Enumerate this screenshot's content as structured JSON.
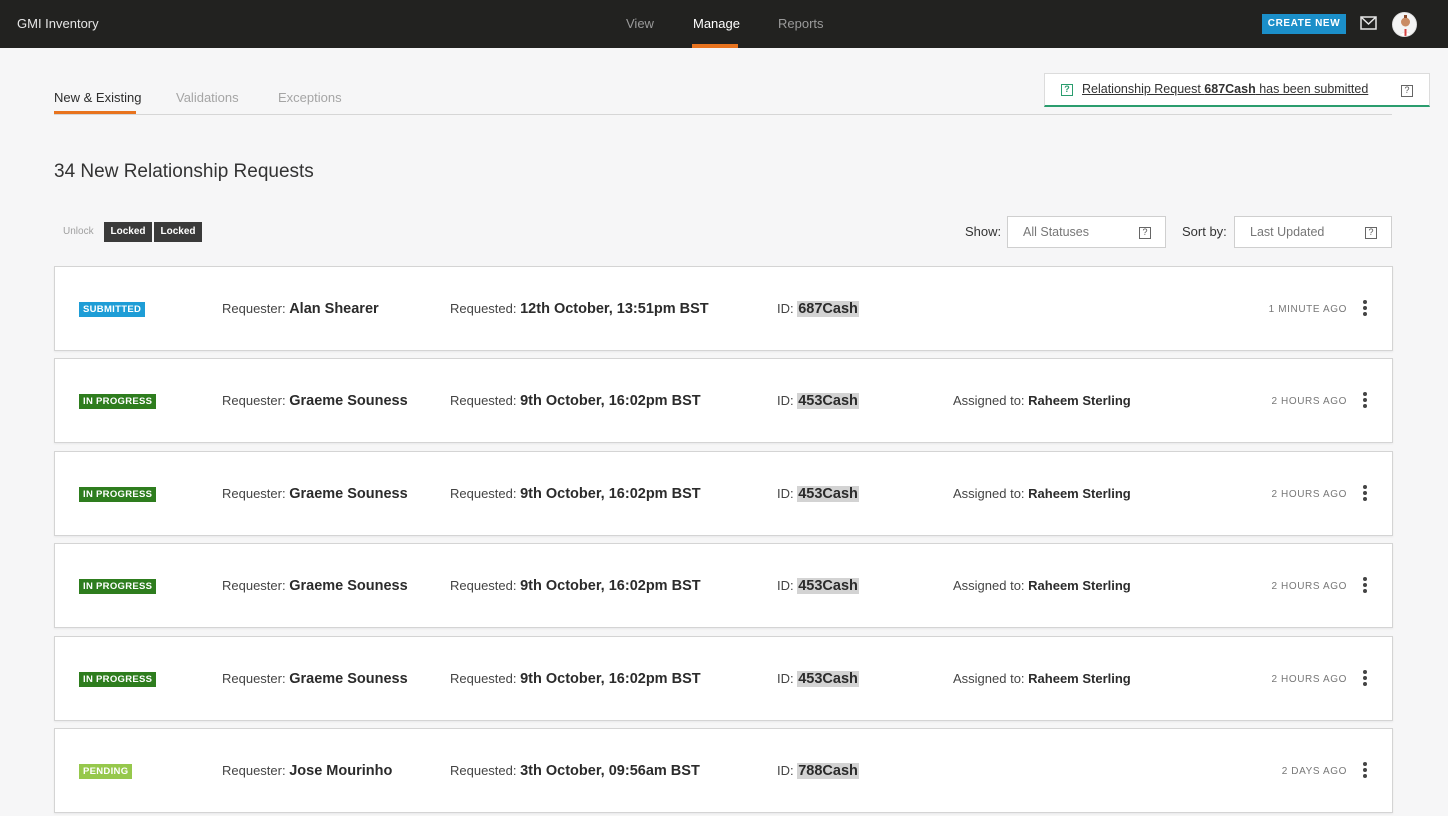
{
  "app": {
    "title": "GMI Inventory"
  },
  "nav": {
    "items": [
      {
        "label": "View"
      },
      {
        "label": "Manage"
      },
      {
        "label": "Reports"
      }
    ],
    "active": "Manage",
    "create_label": "CREATE NEW"
  },
  "colors": {
    "accent": "#e8731e",
    "create": "#1b8fc9",
    "submitted": "#1e9dd6",
    "in_progress": "#2e7d1e",
    "pending": "#96c84c",
    "success": "#2a9d6e"
  },
  "tabs": [
    {
      "label": "New & Existing"
    },
    {
      "label": "Validations"
    },
    {
      "label": "Exceptions"
    }
  ],
  "notification": {
    "prefix": "Relationship Request ",
    "id": "687Cash",
    "suffix": " has been submitted"
  },
  "heading": "34 New Relationship Requests",
  "lock": {
    "unlock_label": "Unlock",
    "locked_label_1": "Locked",
    "locked_label_2": "Locked"
  },
  "filters": {
    "show_label": "Show:",
    "show_value": "All Statuses",
    "sort_label": "Sort by:",
    "sort_value": "Last Updated"
  },
  "labels": {
    "requester": "Requester: ",
    "requested": "Requested: ",
    "id": "ID: ",
    "assigned": "Assigned to: "
  },
  "requests": [
    {
      "status": "SUBMITTED",
      "requester": "Alan Shearer",
      "requested": "12th October, 13:51pm BST",
      "id": "687Cash",
      "assigned": "",
      "time": "1 MINUTE AGO"
    },
    {
      "status": "IN PROGRESS",
      "requester": "Graeme Souness",
      "requested": "9th October, 16:02pm BST",
      "id": "453Cash",
      "assigned": "Raheem Sterling",
      "time": "2 HOURS AGO"
    },
    {
      "status": "IN PROGRESS",
      "requester": "Graeme Souness",
      "requested": "9th October, 16:02pm BST",
      "id": "453Cash",
      "assigned": "Raheem Sterling",
      "time": "2 HOURS AGO"
    },
    {
      "status": "IN PROGRESS",
      "requester": "Graeme Souness",
      "requested": "9th October, 16:02pm BST",
      "id": "453Cash",
      "assigned": "Raheem Sterling",
      "time": "2 HOURS AGO"
    },
    {
      "status": "IN PROGRESS",
      "requester": "Graeme Souness",
      "requested": "9th October, 16:02pm BST",
      "id": "453Cash",
      "assigned": "Raheem Sterling",
      "time": "2 HOURS AGO"
    },
    {
      "status": "PENDING",
      "requester": "Jose Mourinho",
      "requested": "3th October, 09:56am BST",
      "id": "788Cash",
      "assigned": "",
      "time": "2 DAYS AGO"
    }
  ]
}
